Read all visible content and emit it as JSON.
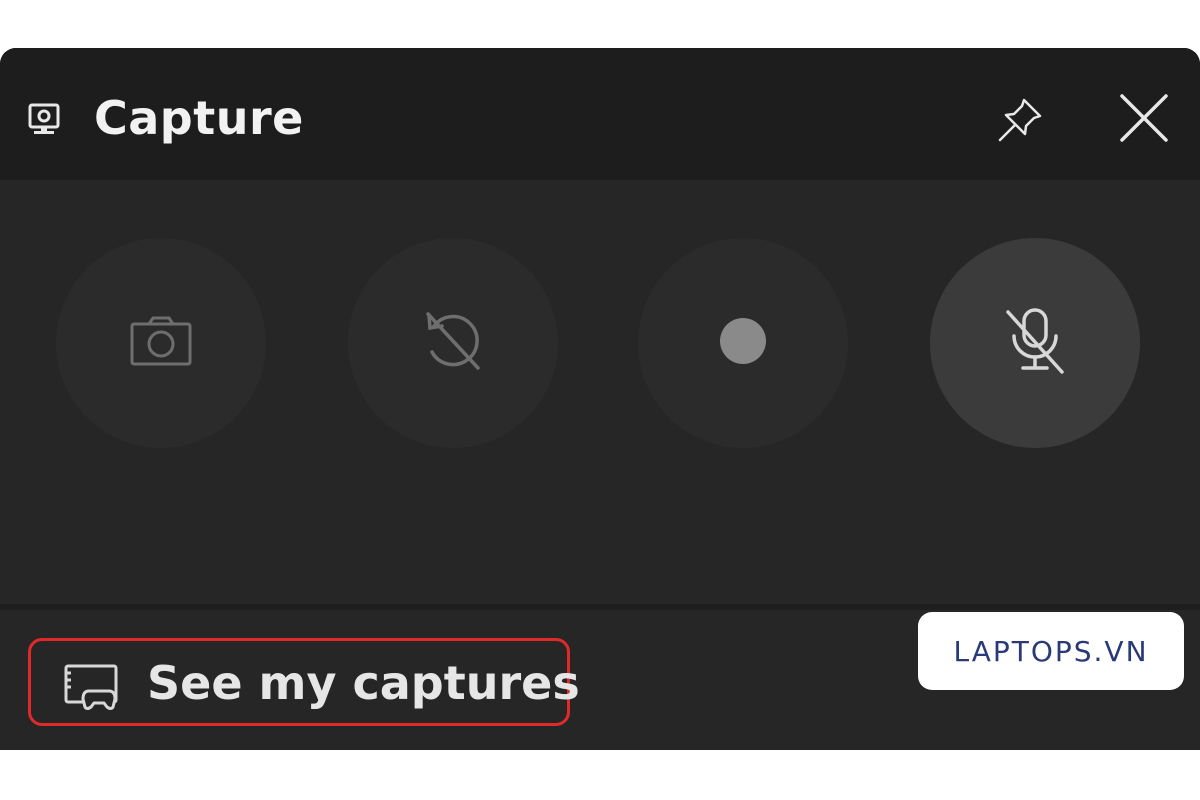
{
  "window": {
    "title": "Capture",
    "title_icon": "monitor-camera-icon",
    "pin_icon": "pin-icon",
    "close_icon": "close-icon"
  },
  "controls": [
    {
      "name": "screenshot-button",
      "icon": "camera-icon",
      "active": false
    },
    {
      "name": "record-last-30-seconds-button",
      "icon": "history-off-icon",
      "active": false
    },
    {
      "name": "start-recording-button",
      "icon": "record-dot-icon",
      "active": false
    },
    {
      "name": "microphone-toggle-button",
      "icon": "microphone-off-icon",
      "active": true
    }
  ],
  "footer": {
    "see_captures_label": "See my captures",
    "see_captures_icon": "gallery-controller-icon"
  },
  "colors": {
    "highlight": "#e02a2a",
    "titlebar": "#1d1d1d",
    "panel": "#262626"
  },
  "watermark": {
    "text": "LAPTOPS.VN"
  }
}
